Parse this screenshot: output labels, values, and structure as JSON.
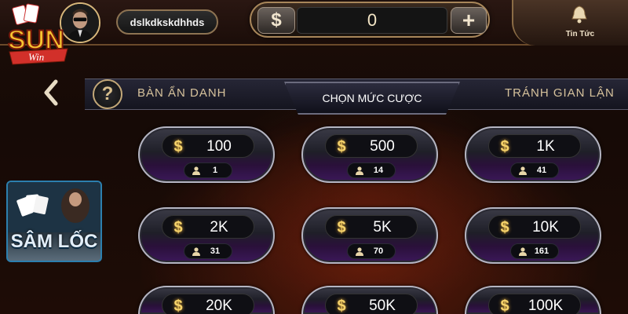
{
  "header": {
    "logo_text": "SUN",
    "logo_sub": "Win",
    "username": "dslkdkskdhhds",
    "currency_symbol": "$",
    "balance": "0",
    "add_symbol": "+",
    "news_label": "Tin Tức"
  },
  "tabs": {
    "anonymous": "BÀN ẨN DANH",
    "choose_bet": "CHỌN MỨC CƯỢC",
    "anti_cheat": "TRÁNH GIAN LẬN"
  },
  "game": {
    "name": "SÂM LỐC"
  },
  "bets": [
    {
      "amount": "100",
      "players": "1"
    },
    {
      "amount": "500",
      "players": "14"
    },
    {
      "amount": "1K",
      "players": "41"
    },
    {
      "amount": "2K",
      "players": "31"
    },
    {
      "amount": "5K",
      "players": "70"
    },
    {
      "amount": "10K",
      "players": "161"
    },
    {
      "amount": "20K",
      "players": ""
    },
    {
      "amount": "50K",
      "players": ""
    },
    {
      "amount": "100K",
      "players": ""
    }
  ],
  "icons": {
    "bell": "bell-icon",
    "back": "chevron-left-icon",
    "help": "question-icon",
    "user": "user-icon",
    "coin": "dollar-icon"
  },
  "colors": {
    "accent_gold": "#f5d26a",
    "bet_border": "#b5b5c2",
    "game_card_border": "#2c7fae"
  }
}
